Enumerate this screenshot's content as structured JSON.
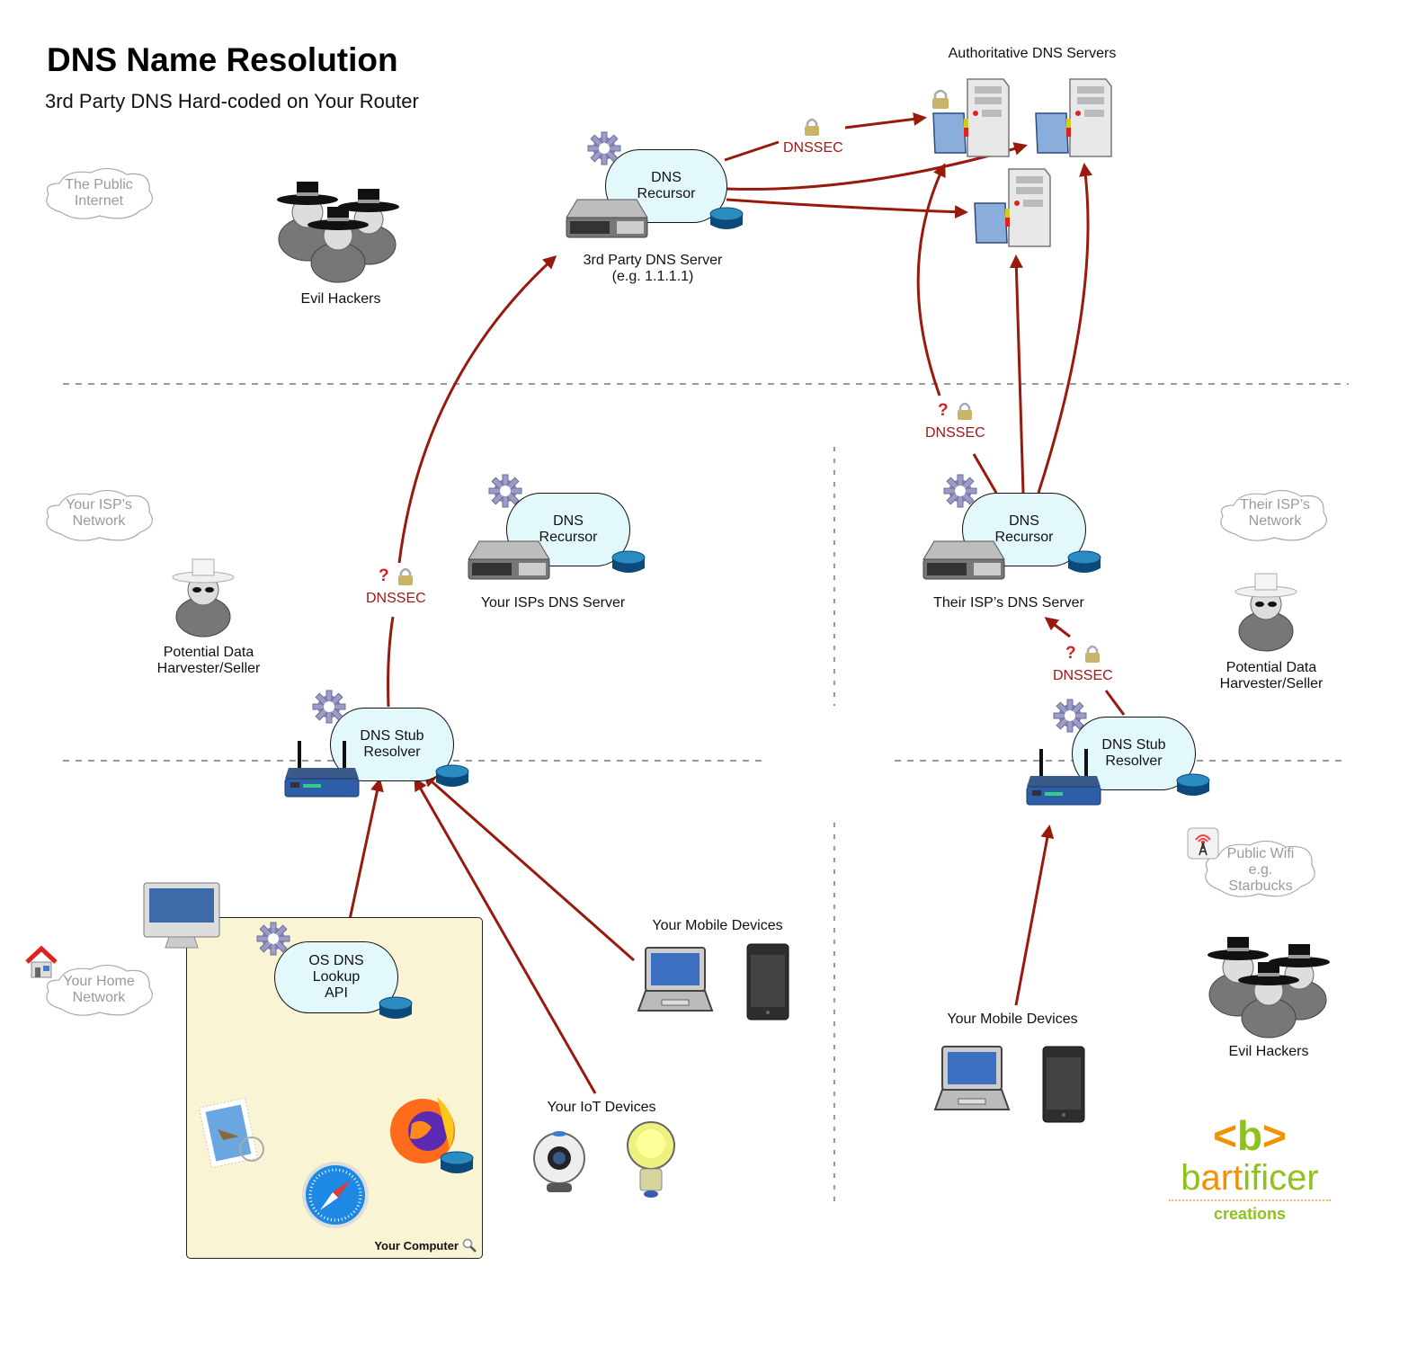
{
  "header": {
    "title": "DNS Name Resolution",
    "subtitle": "3rd Party DNS Hard-coded on Your Router"
  },
  "zones": {
    "public_internet": "The Public\nInternet",
    "your_isp": "Your ISP’s\nNetwork",
    "their_isp": "Their ISP’s\nNetwork",
    "home": "Your Home\nNetwork",
    "public_wifi": "Public Wifi\ne.g.\nStarbucks"
  },
  "nodes": {
    "authoritative_label": "Authoritative DNS Servers",
    "third_party_recursor": "DNS\nRecursor",
    "third_party_label": "3rd Party DNS Server\n(e.g. 1.1.1.1)",
    "your_isp_recursor": "DNS\nRecursor",
    "your_isp_label": "Your ISPs DNS Server",
    "their_isp_recursor": "DNS\nRecursor",
    "their_isp_label": "Their ISP’s DNS Server",
    "home_stub": "DNS Stub\nResolver",
    "wifi_stub": "DNS Stub\nResolver",
    "os_api": "OS DNS\nLookup\nAPI",
    "your_computer": "Your Computer",
    "home_mobile_label": "Your Mobile Devices",
    "iot_label": "Your IoT Devices",
    "wifi_mobile_label": "Your Mobile Devices"
  },
  "actors": {
    "evil_hackers_top": "Evil Hackers",
    "harvester_left": "Potential Data\nHarvester/Seller",
    "harvester_right": "Potential Data\nHarvester/Seller",
    "evil_hackers_bottom": "Evil Hackers"
  },
  "annotations": {
    "dnssec": "DNSSEC",
    "unknown": "?"
  },
  "logo": {
    "mark_open": "<",
    "mark_b": "b",
    "mark_close": ">",
    "name_part1": "b",
    "name_part2": "art",
    "name_part3": "ificer",
    "tagline": "creations"
  },
  "colors": {
    "arrow": "#981a0c",
    "dnssec_text": "#a01818",
    "pill_fill": "#e2f8fb",
    "computer_box": "#f8f4d4",
    "logo_green": "#8dc21f",
    "logo_orange": "#f39200"
  }
}
